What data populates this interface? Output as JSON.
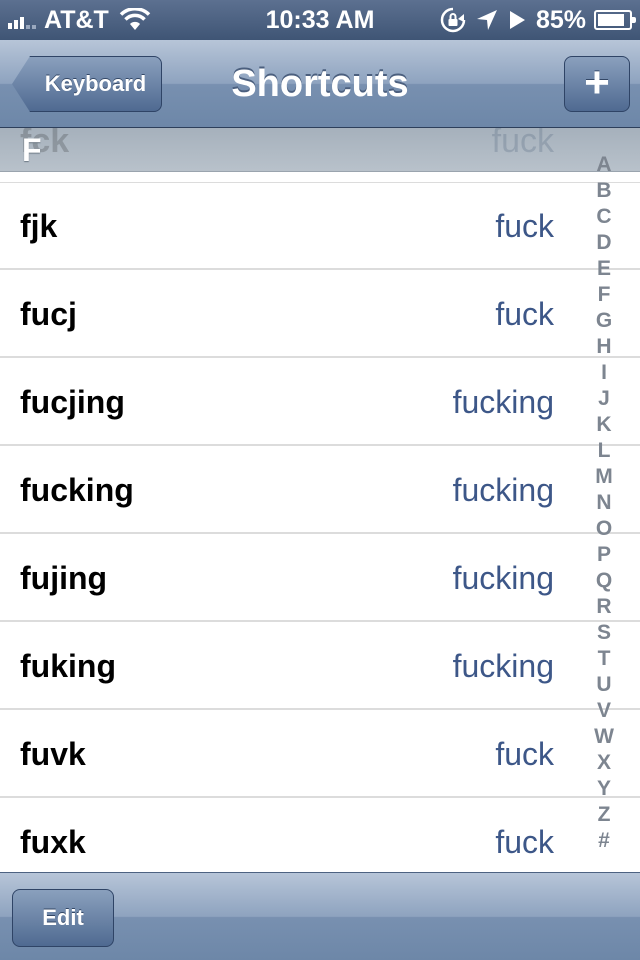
{
  "status_bar": {
    "carrier": "AT&T",
    "time": "10:33 AM",
    "battery_percent": "85%",
    "battery_level": 0.85,
    "signal_bars": 3,
    "icons": [
      "signal-icon",
      "wifi-icon",
      "rotation-lock-icon",
      "location-icon",
      "play-icon",
      "battery-icon"
    ]
  },
  "nav": {
    "back_label": "Keyboard",
    "title": "Shortcuts",
    "add_label": "+"
  },
  "section": {
    "letter": "F",
    "ghost_shortcut": "fck",
    "ghost_phrase": "fuck"
  },
  "rows": [
    {
      "shortcut": "fjk",
      "phrase": "fuck"
    },
    {
      "shortcut": "fucj",
      "phrase": "fuck"
    },
    {
      "shortcut": "fucjing",
      "phrase": "fucking"
    },
    {
      "shortcut": "fucking",
      "phrase": "fucking"
    },
    {
      "shortcut": "fujing",
      "phrase": "fucking"
    },
    {
      "shortcut": "fuking",
      "phrase": "fucking"
    },
    {
      "shortcut": "fuvk",
      "phrase": "fuck"
    },
    {
      "shortcut": "fuxk",
      "phrase": "fuck"
    }
  ],
  "index": [
    "A",
    "B",
    "C",
    "D",
    "E",
    "F",
    "G",
    "H",
    "I",
    "J",
    "K",
    "L",
    "M",
    "N",
    "O",
    "P",
    "Q",
    "R",
    "S",
    "T",
    "U",
    "V",
    "W",
    "X",
    "Y",
    "Z",
    "#"
  ],
  "toolbar": {
    "edit_label": "Edit"
  },
  "colors": {
    "phrase_text": "#3d5788",
    "bar_blue": "#6d87a8",
    "index_gray": "#7d8590"
  }
}
